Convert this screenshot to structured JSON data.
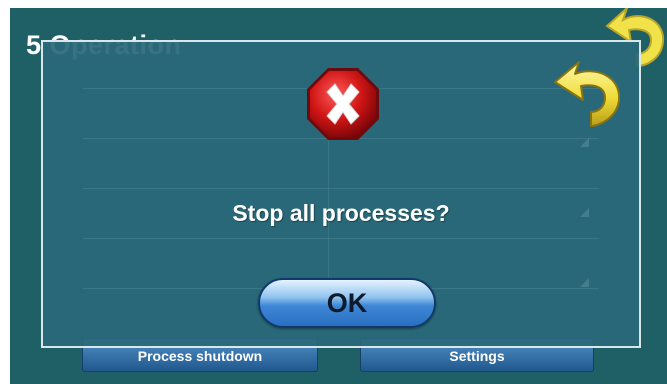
{
  "background_screen": {
    "title": "5 Operation",
    "left_button_label": "Process shutdown",
    "right_button_label": "Settings"
  },
  "dialog": {
    "message": "Stop all processes?",
    "ok_label": "OK",
    "stop_icon": "error-octagon-x-icon",
    "back_icon": "back-arrow-icon"
  },
  "colors": {
    "background": "#1f5f66",
    "dialog_panel": "#2a687a",
    "ok_button": "#3f87d6",
    "stop_icon": "#c0101a",
    "back_arrow": "#f2e24a"
  }
}
